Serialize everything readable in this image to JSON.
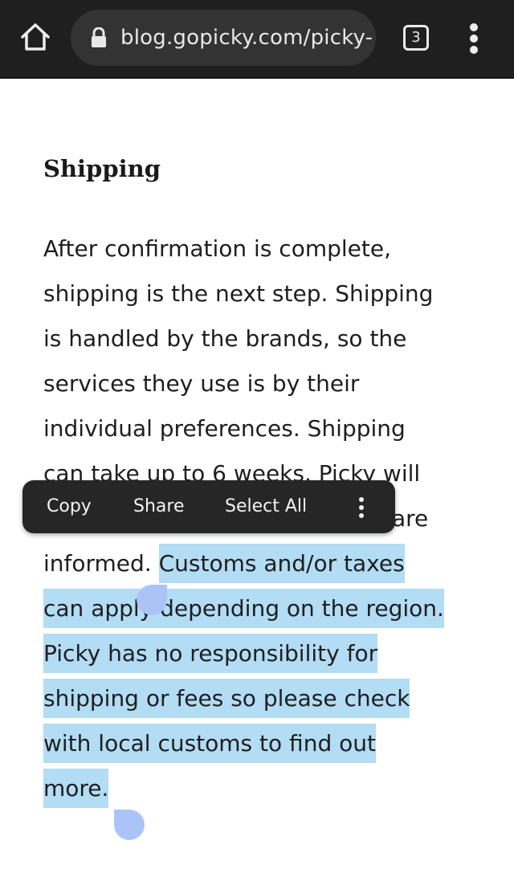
{
  "browser": {
    "url": "blog.gopicky.com/picky-",
    "tab_count": "3",
    "icons": {
      "home": "home-icon",
      "lock": "lock-icon",
      "menu": "more-vertical-icon"
    }
  },
  "article": {
    "heading": "Shipping",
    "lines": [
      {
        "text": "After confirmation is complete,"
      },
      {
        "text": "shipping is the next step. Shipping"
      },
      {
        "text": "is handled by the brands, so the"
      },
      {
        "text": "services they use is by their"
      },
      {
        "text": "individual preferences. Shipping"
      },
      {
        "text": "can take up to 6 weeks. Picky will"
      },
      {
        "text": "are"
      },
      {
        "text": "informed. ",
        "selected": "Customs and/or taxes"
      },
      {
        "selected": "can apply depending on the region."
      },
      {
        "selected": "Picky has no responsibility for"
      },
      {
        "selected": "shipping or fees so please check"
      },
      {
        "selected": "with local customs to find out"
      },
      {
        "selected": "more."
      }
    ]
  },
  "selection_toolbar": {
    "copy": "Copy",
    "share": "Share",
    "select_all": "Select All",
    "more_icon": "more-vertical-icon"
  },
  "colors": {
    "toolbar_bg": "#1f1f1f",
    "url_pill_bg": "#333333",
    "selection_highlight": "#b3dcf5",
    "selection_handle": "#aac4f8",
    "context_menu_bg": "#262626"
  }
}
